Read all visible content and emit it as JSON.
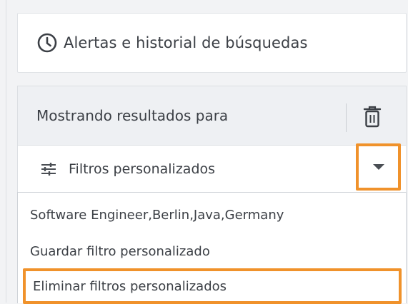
{
  "alerts": {
    "label": "Alertas e historial de búsquedas",
    "icon": "clock-icon"
  },
  "results": {
    "title": "Mostrando resultados para",
    "delete_icon": "trash-icon"
  },
  "filters": {
    "label": "Filtros personalizados",
    "icon": "sliders-icon",
    "toggle_icon": "caret-down-icon"
  },
  "dropdown": {
    "items": [
      {
        "label": "Software Engineer,Berlin,Java,Germany"
      },
      {
        "label": "Guardar filtro personalizado"
      },
      {
        "label": "Eliminar filtros personalizados"
      }
    ]
  },
  "colors": {
    "highlight": "#f0922b",
    "panel_bg": "#eef0f3",
    "text": "#3b3f45"
  }
}
